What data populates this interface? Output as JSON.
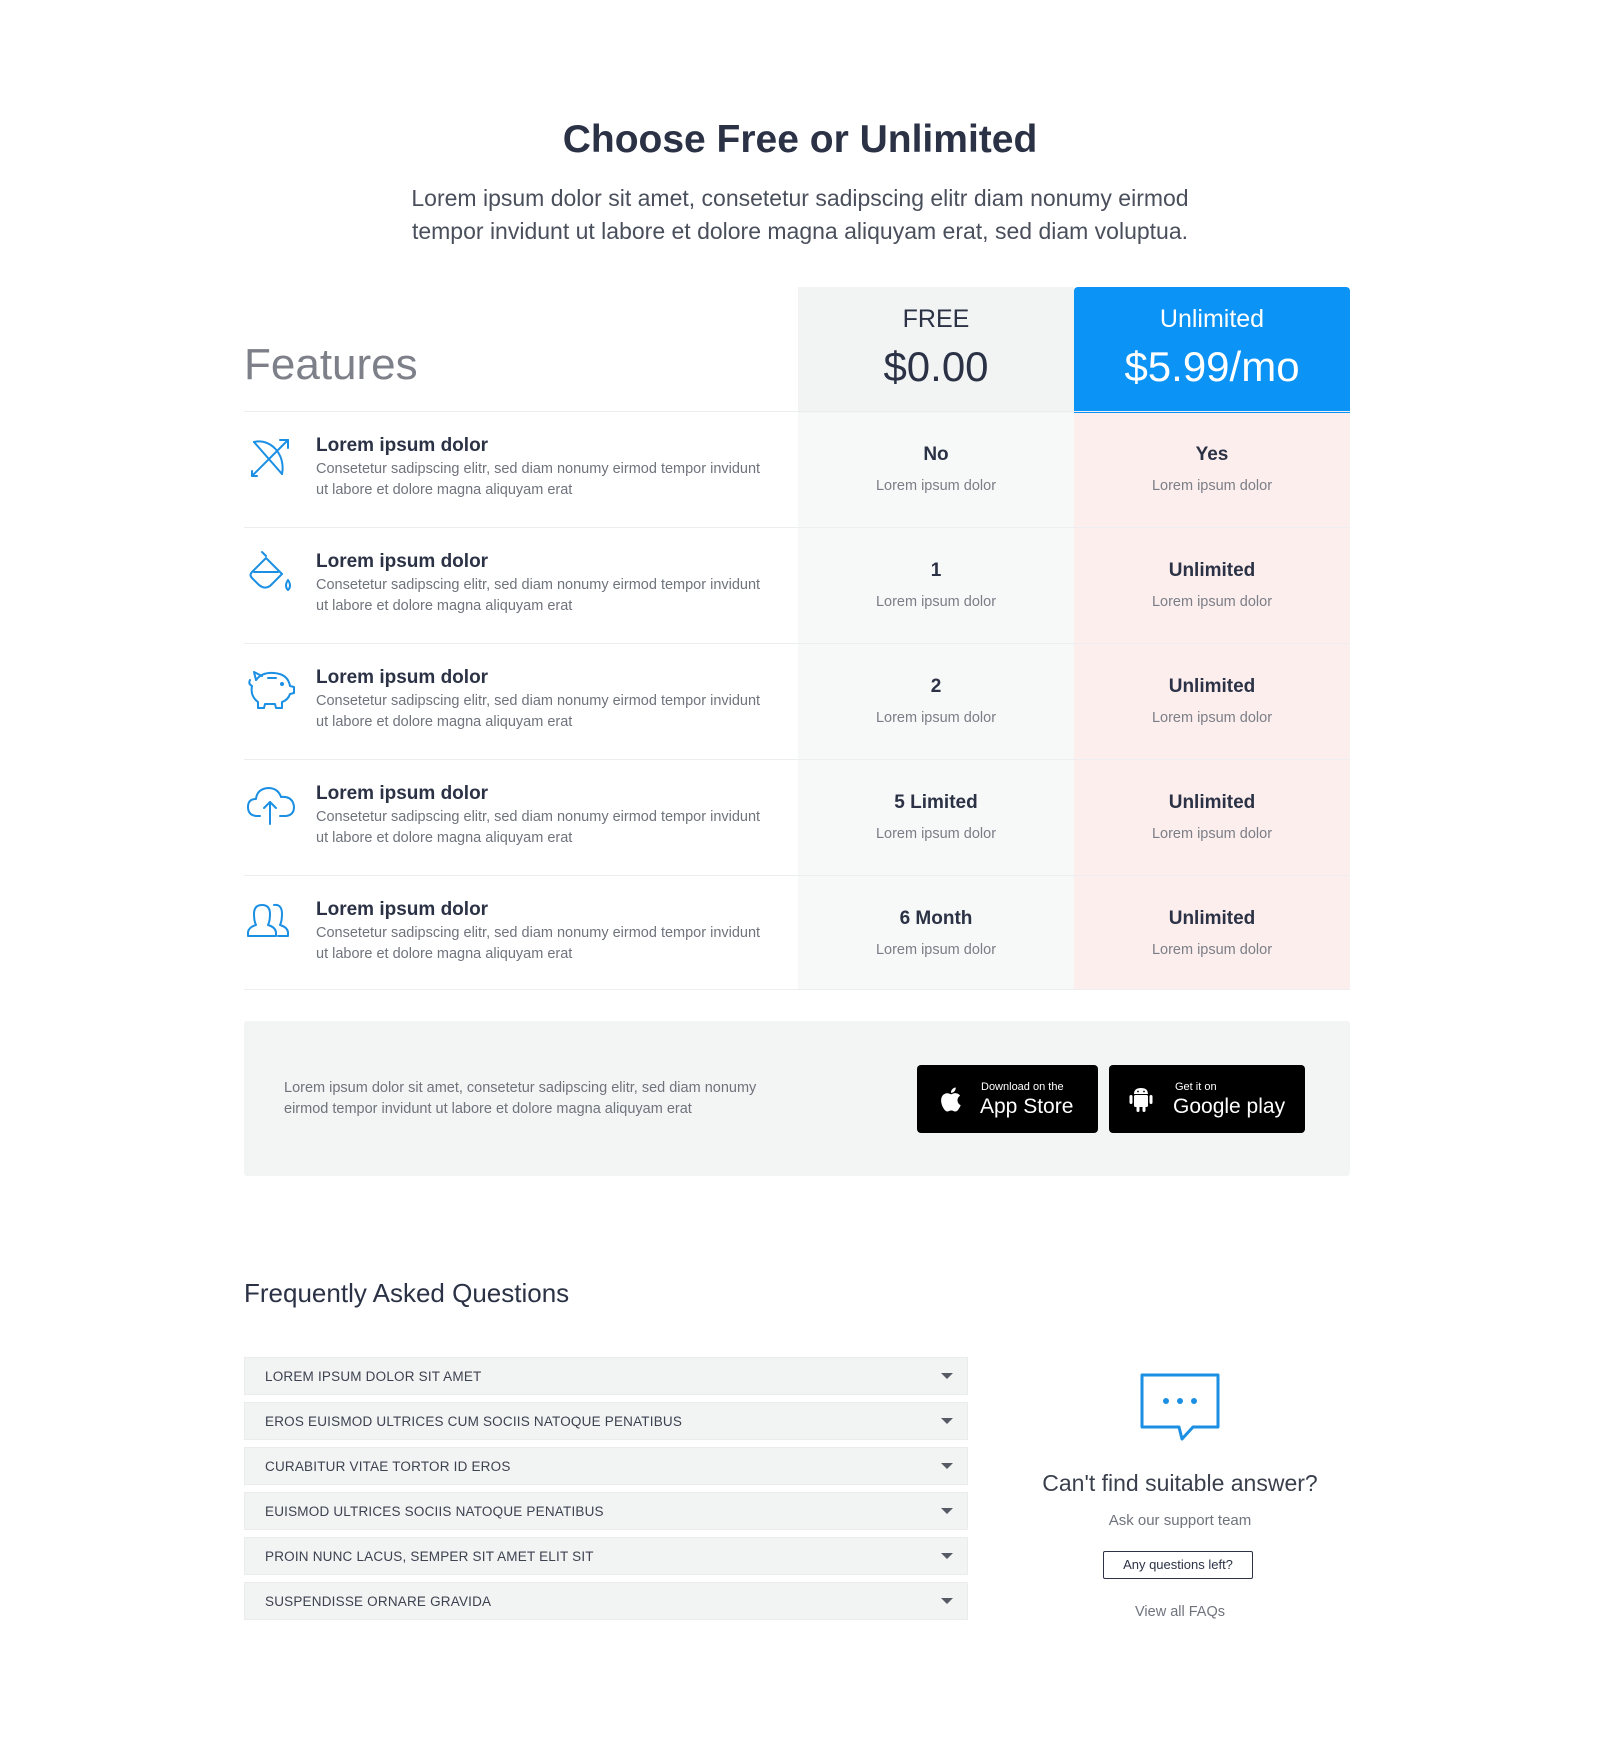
{
  "header": {
    "title": "Choose Free or Unlimited",
    "subtitle_line1": "Lorem ipsum dolor sit amet, consetetur sadipscing elitr diam nonumy eirmod",
    "subtitle_line2": "tempor invidunt ut labore et dolore magna aliquyam erat, sed diam voluptua."
  },
  "pricing": {
    "features_label": "Features",
    "plans": [
      {
        "name": "FREE",
        "price": "$0.00"
      },
      {
        "name": "Unlimited",
        "price": "$5.99/mo",
        "accent": "#0b93f6"
      }
    ],
    "rows": [
      {
        "icon": "bow-arrow-icon",
        "title": "Lorem ipsum dolor",
        "desc_line1": "Consetetur sadipscing elitr, sed diam nonumy eirmod tempor invidunt",
        "desc_line2": "ut labore et dolore magna aliquyam erat",
        "free": "No",
        "free_sub": "Lorem ipsum dolor",
        "unlimited": "Yes",
        "unlimited_sub": "Lorem ipsum dolor"
      },
      {
        "icon": "paint-bucket-icon",
        "title": "Lorem ipsum dolor",
        "desc_line1": "Consetetur sadipscing elitr, sed diam nonumy eirmod tempor invidunt",
        "desc_line2": "ut labore et dolore magna aliquyam erat",
        "free": "1",
        "free_sub": "Lorem ipsum dolor",
        "unlimited": "Unlimited",
        "unlimited_sub": "Lorem ipsum dolor"
      },
      {
        "icon": "piggy-bank-icon",
        "title": "Lorem ipsum dolor",
        "desc_line1": "Consetetur sadipscing elitr, sed diam nonumy eirmod tempor invidunt",
        "desc_line2": "ut labore et dolore magna aliquyam erat",
        "free": "2",
        "free_sub": "Lorem ipsum dolor",
        "unlimited": "Unlimited",
        "unlimited_sub": "Lorem ipsum dolor"
      },
      {
        "icon": "cloud-upload-icon",
        "title": "Lorem ipsum dolor",
        "desc_line1": "Consetetur sadipscing elitr, sed diam nonumy eirmod tempor invidunt",
        "desc_line2": "ut labore et dolore magna aliquyam erat",
        "free": "5 Limited",
        "free_sub": "Lorem ipsum dolor",
        "unlimited": "Unlimited",
        "unlimited_sub": "Lorem ipsum dolor"
      },
      {
        "icon": "users-icon",
        "title": "Lorem ipsum dolor",
        "desc_line1": "Consetetur sadipscing elitr, sed diam nonumy eirmod tempor invidunt",
        "desc_line2": "ut labore et dolore magna aliquyam erat",
        "free": "6 Month",
        "free_sub": "Lorem ipsum dolor",
        "unlimited": "Unlimited",
        "unlimited_sub": "Lorem ipsum dolor"
      }
    ]
  },
  "app_banner": {
    "text_line1": "Lorem ipsum dolor sit amet, consetetur sadipscing elitr, sed diam nonumy",
    "text_line2": "eirmod tempor invidunt ut labore et dolore magna aliquyam erat",
    "app_store": {
      "small": "Download on the",
      "big": "App Store",
      "icon": "apple-icon"
    },
    "google_play": {
      "small": "Get it on",
      "big": "Google play",
      "icon": "android-icon"
    }
  },
  "faq": {
    "title": "Frequently Asked Questions",
    "items": [
      "LOREM IPSUM DOLOR SIT AMET",
      "EROS EUISMOD ULTRICES CUM SOCIIS NATOQUE PENATIBUS",
      "CURABITUR VITAE TORTOR ID EROS",
      "EUISMOD ULTRICES SOCIIS NATOQUE PENATIBUS",
      "PROIN NUNC LACUS, SEMPER SIT AMET ELIT SIT",
      "SUSPENDISSE ORNARE GRAVIDA"
    ],
    "help": {
      "icon": "chat-bubble-icon",
      "title": "Can't find suitable answer?",
      "subtitle": "Ask our support team",
      "button": "Any questions left?",
      "link": "View all FAQs"
    }
  },
  "colors": {
    "accent": "#0b93f6",
    "icon": "#1a8fe3",
    "unlimited_column": "#fdeeee",
    "free_column": "#f7f8f8"
  }
}
